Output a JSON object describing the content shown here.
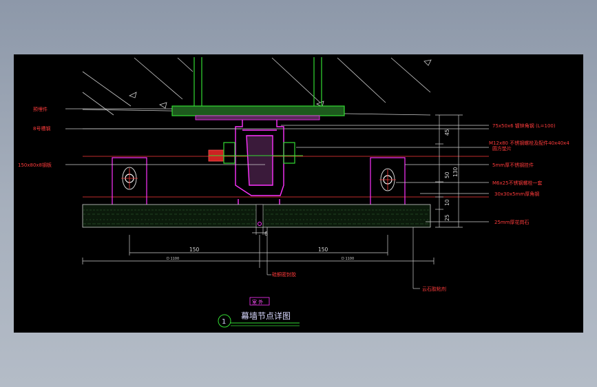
{
  "colors": {
    "background": "#000000",
    "frame_green": "#33dd33",
    "steel_magenta": "#ff33ff",
    "stone_green": "#22aa55",
    "label_red": "#ff3b3b",
    "dimension_white": "#d8d8d8",
    "title_blue": "#d8d8ff"
  },
  "labels_left": [
    {
      "key": "embed",
      "text": "预埋件"
    },
    {
      "key": "channel",
      "text": "8号槽钢"
    },
    {
      "key": "plate",
      "text": "150x80x8钢板"
    }
  ],
  "labels_right": [
    {
      "key": "angle",
      "text": "75x50x6  镀锌角钢  (L=100)"
    },
    {
      "key": "bolt",
      "text": "M12x80  不锈钢螺栓及配件40x40x4"
    },
    {
      "key": "bolt2",
      "text": "圆方垫片"
    },
    {
      "key": "pendant",
      "text": "5mm厚不锈钢挂件"
    },
    {
      "key": "bolt3",
      "text": "M6x25不锈钢螺栓一套"
    },
    {
      "key": "angle2",
      "text": "30x30x5mm厚角钢"
    },
    {
      "key": "stone",
      "text": "25mm厚花岗石"
    }
  ],
  "labels_bottom": [
    {
      "key": "sealant",
      "text": "硅酮密封胶"
    },
    {
      "key": "stone_glue",
      "text": "云石胶粘剂"
    }
  ],
  "dimensions": {
    "right_45": "45",
    "right_50": "50",
    "right_130": "130",
    "right_10": "10",
    "right_25": "25",
    "gap_6": "6",
    "left_150": "150",
    "right_150": "150",
    "left_d": "D 1100",
    "right_d": "D 1100"
  },
  "tag": "室  外",
  "title": "幕墙节点详图",
  "detail_number": "1"
}
